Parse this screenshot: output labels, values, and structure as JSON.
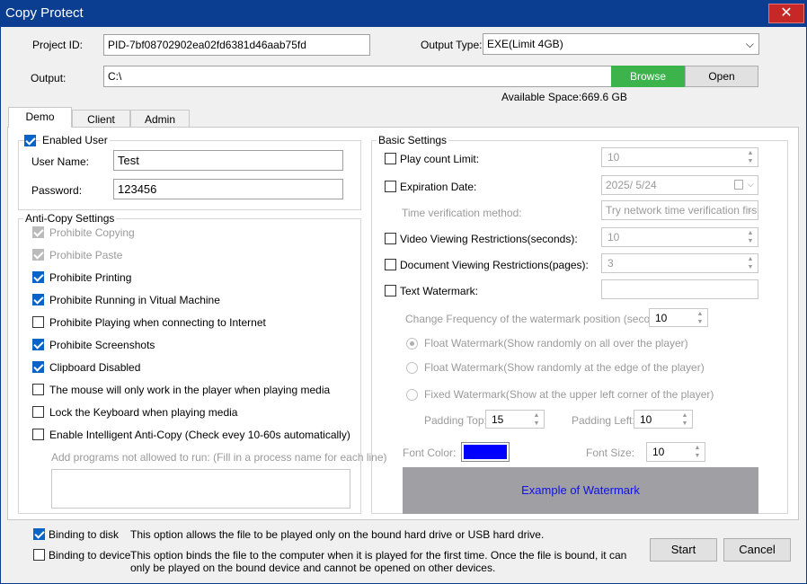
{
  "window": {
    "title": "Copy Protect",
    "close_glyph": "✕"
  },
  "header": {
    "project_id_label": "Project ID:",
    "project_id_value": "PID-7bf08702902ea02fd6381d46aab75fd",
    "output_type_label": "Output Type:",
    "output_type_value": "EXE(Limit 4GB)",
    "output_label": "Output:",
    "output_value": "C:\\",
    "browse_label": "Browse",
    "open_label": "Open",
    "available_space": "Available Space:669.6 GB"
  },
  "tabs": [
    {
      "label": "Demo",
      "active": true
    },
    {
      "label": "Client",
      "active": false
    },
    {
      "label": "Admin",
      "active": false
    }
  ],
  "user": {
    "enabled_label": "Enabled User",
    "enabled_checked": true,
    "username_label": "User Name:",
    "username_value": "Test",
    "password_label": "Password:",
    "password_value": "123456"
  },
  "anti_copy": {
    "title": "Anti-Copy Settings",
    "items": [
      {
        "label": "Prohibite Copying",
        "checked": true,
        "disabled": true
      },
      {
        "label": "Prohibite Paste",
        "checked": true,
        "disabled": true
      },
      {
        "label": "Prohibite Printing",
        "checked": true,
        "disabled": false
      },
      {
        "label": "Prohibite Running in Vitual Machine",
        "checked": true,
        "disabled": false
      },
      {
        "label": "Prohibite Playing when connecting to Internet",
        "checked": false,
        "disabled": false
      },
      {
        "label": "Prohibite Screenshots",
        "checked": true,
        "disabled": false
      },
      {
        "label": "Clipboard Disabled",
        "checked": true,
        "disabled": false
      },
      {
        "label": "The mouse will only work in the player when playing media",
        "checked": false,
        "disabled": false
      },
      {
        "label": "Lock the Keyboard when playing media",
        "checked": false,
        "disabled": false
      },
      {
        "label": "Enable Intelligent Anti-Copy (Check evey 10-60s automatically)",
        "checked": false,
        "disabled": false
      }
    ],
    "programs_hint": "Add programs not allowed to run: (Fill in a process name for each line)",
    "programs_value": ""
  },
  "basic": {
    "title": "Basic Settings",
    "play_count_label": "Play count Limit:",
    "play_count_value": "10",
    "expiration_label": "Expiration Date:",
    "expiration_value": "2025/  5/24",
    "time_method_label": "Time verification method:",
    "time_method_value": "Try network time verification first",
    "video_label": "Video Viewing Restrictions(seconds):",
    "video_value": "10",
    "doc_label": "Document Viewing Restrictions(pages):",
    "doc_value": "3",
    "watermark_label": "Text Watermark:",
    "watermark_value": "",
    "change_freq_label": "Change Frequency of the watermark position (second):",
    "change_freq_value": "10",
    "float_all_label": "Float Watermark(Show randomly on all over the player)",
    "float_edge_label": "Float Watermark(Show randomly at the edge of the player)",
    "fixed_label": "Fixed Watermark(Show at the upper left corner of the player)",
    "padding_top_label": "Padding Top:",
    "padding_top_value": "15",
    "padding_left_label": "Padding Left:",
    "padding_left_value": "10",
    "font_color_label": "Font Color:",
    "font_color": "#0000ff",
    "font_size_label": "Font Size:",
    "font_size_value": "10",
    "example_label": "Example of Watermark"
  },
  "footer": {
    "bind_disk_label": "Binding to disk",
    "bind_disk_checked": true,
    "bind_disk_desc": "This option allows the file to be played only on the bound hard drive or USB hard drive.",
    "bind_device_label": "Binding to device",
    "bind_device_checked": false,
    "bind_device_desc": "This option binds the file to the computer when it is played for the first time. Once the file is bound, it can only be played on the bound device and cannot be opened on other devices.",
    "start_label": "Start",
    "cancel_label": "Cancel"
  },
  "colors": {
    "title_bar": "#0b3d91",
    "browse_green": "#3cb44b",
    "close_red": "#c62828",
    "check_blue": "#0a64c8"
  }
}
